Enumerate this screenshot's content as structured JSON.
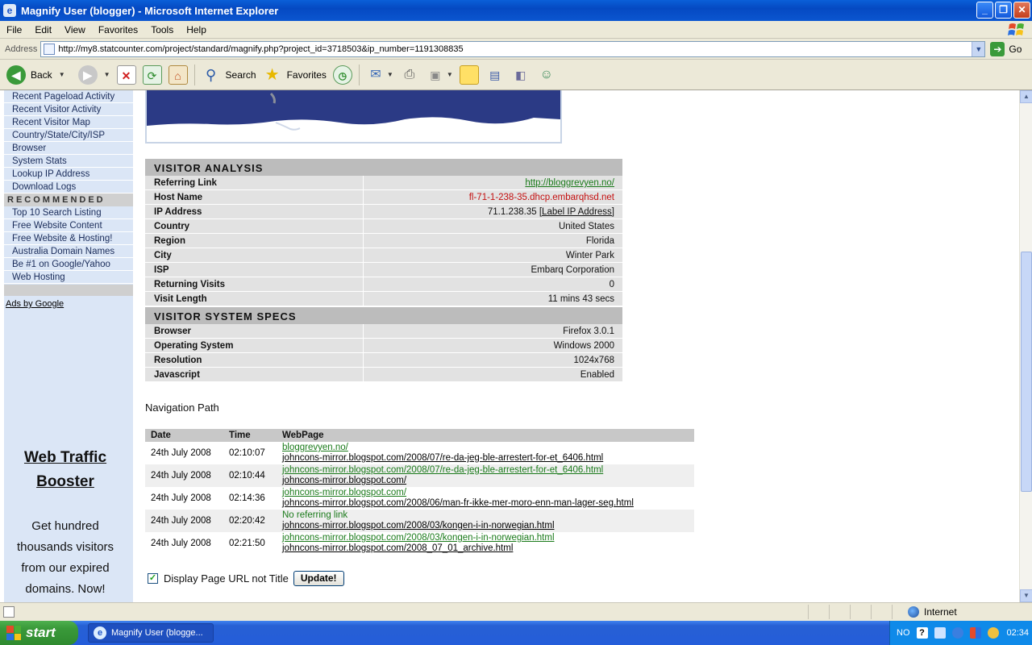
{
  "window": {
    "title": "Magnify User (blogger) - Microsoft Internet Explorer",
    "min": "_",
    "max": "❐",
    "close": "✕"
  },
  "menu": [
    "File",
    "Edit",
    "View",
    "Favorites",
    "Tools",
    "Help"
  ],
  "address": {
    "label": "Address",
    "url": "http://my8.statcounter.com/project/standard/magnify.php?project_id=3718503&ip_number=1191308835",
    "go_label": "Go"
  },
  "toolbar": {
    "back": "Back",
    "search": "Search",
    "favorites": "Favorites"
  },
  "sidebar": {
    "items_top": [
      "Recent Pageload Activity",
      "Recent Visitor Activity",
      "Recent Visitor Map",
      "Country/State/City/ISP",
      "Browser",
      "System Stats",
      "Lookup IP Address",
      "Download Logs"
    ],
    "recommended_heading": "RECOMMENDED",
    "items_recommended": [
      "Top 10 Search Listing",
      "Free Website Content",
      "Free Website & Hosting!",
      "Australia Domain Names",
      "Be #1 on Google/Yahoo",
      "Web Hosting"
    ],
    "ads_by_google": "Ads by Google",
    "ad_title_1": "Web Traffic",
    "ad_title_2": "Booster",
    "ad_body_1": "Get hundred",
    "ad_body_2": "thousands visitors",
    "ad_body_3": "from our expired",
    "ad_body_4": "domains. Now!"
  },
  "visitor_analysis": {
    "heading": "VISITOR ANALYSIS",
    "rows": [
      {
        "key": "Referring Link",
        "value": "http://bloggrevyen.no/"
      },
      {
        "key": "Host Name",
        "value": "fl-71-1-238-35.dhcp.embarqhsd.net"
      },
      {
        "key": "IP Address",
        "value": "71.1.238.35",
        "extra": "[Label IP Address]"
      },
      {
        "key": "Country",
        "value": "United States"
      },
      {
        "key": "Region",
        "value": "Florida"
      },
      {
        "key": "City",
        "value": "Winter Park"
      },
      {
        "key": "ISP",
        "value": "Embarq Corporation"
      },
      {
        "key": "Returning Visits",
        "value": "0"
      },
      {
        "key": "Visit Length",
        "value": "11 mins 43 secs"
      }
    ]
  },
  "system_specs": {
    "heading": "VISITOR SYSTEM SPECS",
    "rows": [
      {
        "key": "Browser",
        "value": "Firefox 3.0.1"
      },
      {
        "key": "Operating System",
        "value": "Windows 2000"
      },
      {
        "key": "Resolution",
        "value": "1024x768"
      },
      {
        "key": "Javascript",
        "value": "Enabled"
      }
    ]
  },
  "navigation": {
    "title": "Navigation Path",
    "headers": [
      "Date",
      "Time",
      "WebPage"
    ],
    "rows": [
      {
        "date": "24th July 2008",
        "time": "02:10:07",
        "ref": "bloggrevyen.no/",
        "page": "johncons-mirror.blogspot.com/2008/07/re-da-jeg-ble-arrestert-for-et_6406.html"
      },
      {
        "date": "24th July 2008",
        "time": "02:10:44",
        "ref": "johncons-mirror.blogspot.com/2008/07/re-da-jeg-ble-arrestert-for-et_6406.html",
        "page": "johncons-mirror.blogspot.com/"
      },
      {
        "date": "24th July 2008",
        "time": "02:14:36",
        "ref": "johncons-mirror.blogspot.com/",
        "page": "johncons-mirror.blogspot.com/2008/06/man-fr-ikke-mer-moro-enn-man-lager-seg.html"
      },
      {
        "date": "24th July 2008",
        "time": "02:20:42",
        "ref": "No referring link",
        "page": "johncons-mirror.blogspot.com/2008/03/kongen-i-in-norwegian.html"
      },
      {
        "date": "24th July 2008",
        "time": "02:21:50",
        "ref": "johncons-mirror.blogspot.com/2008/03/kongen-i-in-norwegian.html",
        "page": "johncons-mirror.blogspot.com/2008_07_01_archive.html"
      }
    ],
    "option_label": "Display Page URL not Title",
    "update_label": "Update!"
  },
  "status": {
    "zone": "Internet"
  },
  "taskbar": {
    "start": "start",
    "task": "Magnify User (blogge...",
    "lang": "NO",
    "clock": "02:34"
  }
}
